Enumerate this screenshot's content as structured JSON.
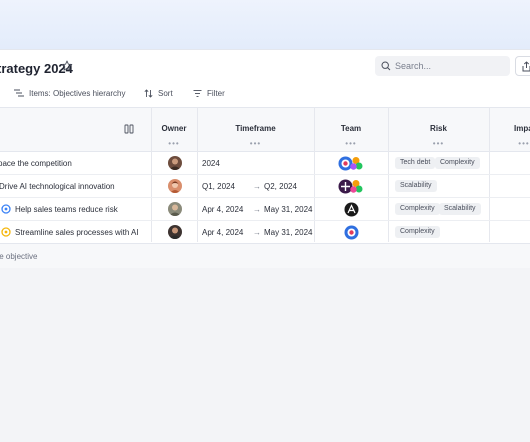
{
  "page": {
    "title": "trategy 2024",
    "search_placeholder": "Search..."
  },
  "toolbar": {
    "items_label": "Items: Objectives hierarchy",
    "sort_label": "Sort",
    "filter_label": "Filter"
  },
  "table": {
    "columns": {
      "owner": "Owner",
      "timeframe": "Timeframe",
      "team": "Team",
      "risk": "Risk",
      "impact": "Impa",
      "more": "•••"
    },
    "rows": [
      {
        "objective": "pace the competition",
        "timeframe_start": "2024",
        "timeframe_end": "",
        "risk": [
          "Tech debt",
          "Complexity"
        ]
      },
      {
        "objective": "Drive AI technological innovation",
        "timeframe_start": "Q1, 2024",
        "arrow": "→",
        "timeframe_end": "Q2, 2024",
        "risk": [
          "Scalability"
        ]
      },
      {
        "objective": "Help sales teams reduce risk",
        "timeframe_start": "Apr 4, 2024",
        "arrow": "→",
        "timeframe_end": "May 31, 2024",
        "risk": [
          "Complexity",
          "Scalability"
        ]
      },
      {
        "objective": "Streamline sales processes with AI",
        "timeframe_start": "Apr 4, 2024",
        "arrow": "→",
        "timeframe_end": "May 31, 2024",
        "risk": [
          "Complexity"
        ]
      }
    ],
    "footer_add": "te objective"
  },
  "colors": {
    "accent_blue": "#3b82f6",
    "status_yellow": "#f5b60a"
  },
  "icons": [
    "star-icon",
    "search-icon",
    "share-icon",
    "hierarchy-icon",
    "sort-icon",
    "filter-icon",
    "columns-icon"
  ]
}
